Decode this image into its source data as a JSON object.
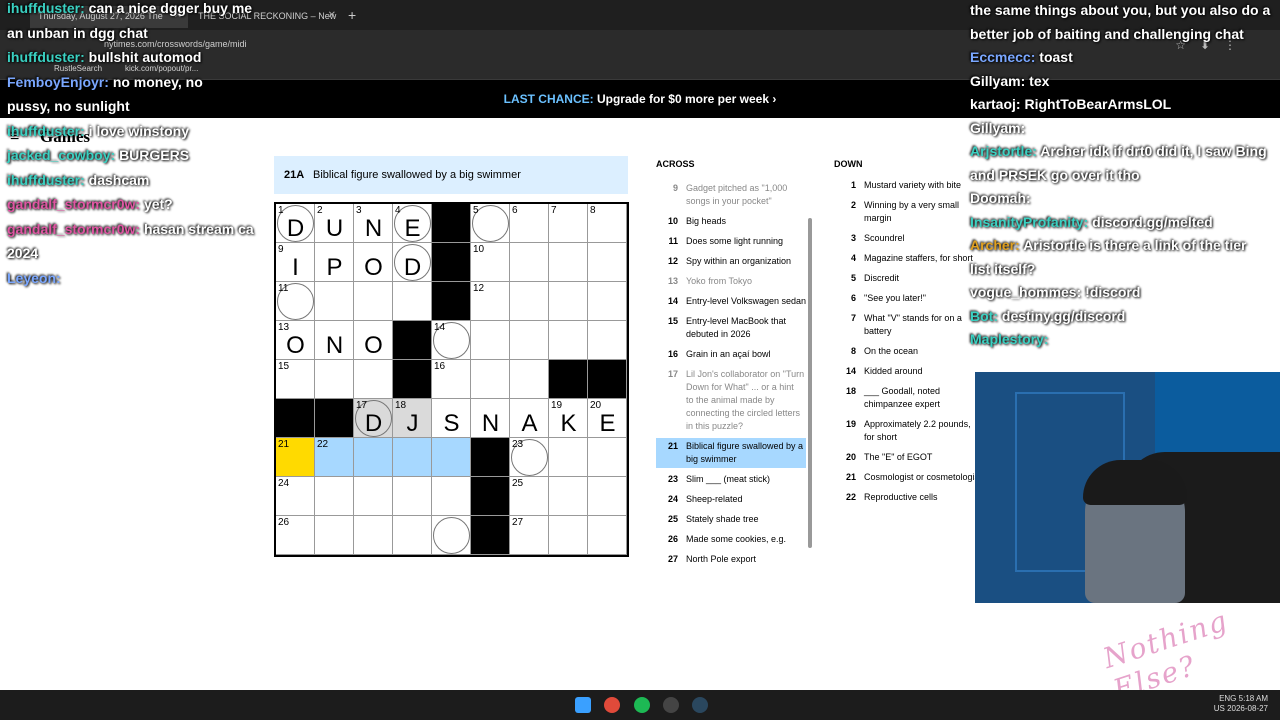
{
  "browser": {
    "tabs": [
      {
        "label": "Thursday, August 27, 2026 The"
      },
      {
        "label": "THE SOCIAL RECKONING – New"
      }
    ],
    "url": "nytimes.com/crosswords/game/midi",
    "bookmarks": [
      {
        "label": "RustleSearch"
      },
      {
        "label": "kick.com/popout/pr..."
      }
    ]
  },
  "banner": {
    "prefix": "LAST CHANCE:",
    "text": "Upgrade for $0 more per week",
    "chevron": "›"
  },
  "brand": {
    "logo": "Games"
  },
  "clue_bar": {
    "number": "21A",
    "text": "Biblical figure swallowed by a big swimmer"
  },
  "grid": {
    "size": 9,
    "cells": [
      {
        "r": 0,
        "c": 0,
        "n": "1",
        "l": "D",
        "circle": true
      },
      {
        "r": 0,
        "c": 1,
        "n": "2",
        "l": "U"
      },
      {
        "r": 0,
        "c": 2,
        "n": "3",
        "l": "N"
      },
      {
        "r": 0,
        "c": 3,
        "n": "4",
        "l": "E",
        "circle": true
      },
      {
        "r": 0,
        "c": 4,
        "black": true
      },
      {
        "r": 0,
        "c": 5,
        "n": "5",
        "circle": true
      },
      {
        "r": 0,
        "c": 6,
        "n": "6"
      },
      {
        "r": 0,
        "c": 7,
        "n": "7"
      },
      {
        "r": 0,
        "c": 8,
        "n": "8"
      },
      {
        "r": 1,
        "c": 0,
        "n": "9",
        "l": "I"
      },
      {
        "r": 1,
        "c": 1,
        "l": "P"
      },
      {
        "r": 1,
        "c": 2,
        "l": "O"
      },
      {
        "r": 1,
        "c": 3,
        "l": "D",
        "circle": true
      },
      {
        "r": 1,
        "c": 4,
        "black": true
      },
      {
        "r": 1,
        "c": 5,
        "n": "10"
      },
      {
        "r": 1,
        "c": 6
      },
      {
        "r": 1,
        "c": 7
      },
      {
        "r": 1,
        "c": 8
      },
      {
        "r": 2,
        "c": 0,
        "n": "11",
        "circle": true
      },
      {
        "r": 2,
        "c": 1
      },
      {
        "r": 2,
        "c": 2
      },
      {
        "r": 2,
        "c": 3
      },
      {
        "r": 2,
        "c": 4,
        "black": true
      },
      {
        "r": 2,
        "c": 5,
        "n": "12"
      },
      {
        "r": 2,
        "c": 6
      },
      {
        "r": 2,
        "c": 7
      },
      {
        "r": 2,
        "c": 8
      },
      {
        "r": 3,
        "c": 0,
        "n": "13",
        "l": "O"
      },
      {
        "r": 3,
        "c": 1,
        "l": "N"
      },
      {
        "r": 3,
        "c": 2,
        "l": "O"
      },
      {
        "r": 3,
        "c": 3,
        "black": true
      },
      {
        "r": 3,
        "c": 4,
        "n": "14",
        "circle": true
      },
      {
        "r": 3,
        "c": 5
      },
      {
        "r": 3,
        "c": 6
      },
      {
        "r": 3,
        "c": 7
      },
      {
        "r": 3,
        "c": 8
      },
      {
        "r": 4,
        "c": 0,
        "n": "15"
      },
      {
        "r": 4,
        "c": 1
      },
      {
        "r": 4,
        "c": 2
      },
      {
        "r": 4,
        "c": 3,
        "black": true
      },
      {
        "r": 4,
        "c": 4,
        "n": "16"
      },
      {
        "r": 4,
        "c": 5
      },
      {
        "r": 4,
        "c": 6
      },
      {
        "r": 4,
        "c": 7,
        "black": true
      },
      {
        "r": 4,
        "c": 8,
        "black": true
      },
      {
        "r": 5,
        "c": 0,
        "black": true
      },
      {
        "r": 5,
        "c": 1,
        "black": true
      },
      {
        "r": 5,
        "c": 2,
        "n": "17",
        "l": "D",
        "rel": true,
        "circle": true
      },
      {
        "r": 5,
        "c": 3,
        "n": "18",
        "l": "J",
        "rel": true
      },
      {
        "r": 5,
        "c": 4,
        "l": "S"
      },
      {
        "r": 5,
        "c": 5,
        "l": "N"
      },
      {
        "r": 5,
        "c": 6,
        "l": "A"
      },
      {
        "r": 5,
        "c": 7,
        "n": "19",
        "l": "K"
      },
      {
        "r": 5,
        "c": 8,
        "n": "20",
        "l": "E"
      },
      {
        "r": 6,
        "c": 0,
        "n": "21",
        "sel": true
      },
      {
        "r": 6,
        "c": 1,
        "n": "22",
        "hl": true
      },
      {
        "r": 6,
        "c": 2,
        "hl": true
      },
      {
        "r": 6,
        "c": 3,
        "hl": true
      },
      {
        "r": 6,
        "c": 4,
        "hl": true
      },
      {
        "r": 6,
        "c": 5,
        "black": true
      },
      {
        "r": 6,
        "c": 6,
        "n": "23",
        "circle": true
      },
      {
        "r": 6,
        "c": 7
      },
      {
        "r": 6,
        "c": 8
      },
      {
        "r": 7,
        "c": 0,
        "n": "24"
      },
      {
        "r": 7,
        "c": 1
      },
      {
        "r": 7,
        "c": 2
      },
      {
        "r": 7,
        "c": 3
      },
      {
        "r": 7,
        "c": 4
      },
      {
        "r": 7,
        "c": 5,
        "black": true
      },
      {
        "r": 7,
        "c": 6,
        "n": "25"
      },
      {
        "r": 7,
        "c": 7
      },
      {
        "r": 7,
        "c": 8
      },
      {
        "r": 8,
        "c": 0,
        "n": "26"
      },
      {
        "r": 8,
        "c": 1
      },
      {
        "r": 8,
        "c": 2
      },
      {
        "r": 8,
        "c": 3
      },
      {
        "r": 8,
        "c": 4,
        "circle": true
      },
      {
        "r": 8,
        "c": 5,
        "black": true
      },
      {
        "r": 8,
        "c": 6,
        "n": "27"
      },
      {
        "r": 8,
        "c": 7
      },
      {
        "r": 8,
        "c": 8
      }
    ]
  },
  "across": {
    "title": "ACROSS",
    "clues": [
      {
        "n": "9",
        "t": "Gadget pitched as \"1,000\nsongs in your pocket\"",
        "dim": true
      },
      {
        "n": "10",
        "t": "Big heads"
      },
      {
        "n": "11",
        "t": "Does some light running"
      },
      {
        "n": "12",
        "t": "Spy within an organization"
      },
      {
        "n": "13",
        "t": "Yoko from Tokyo",
        "dim": true
      },
      {
        "n": "14",
        "t": "Entry-level Volkswagen sedan"
      },
      {
        "n": "15",
        "t": "Entry-level MacBook that\ndebuted in 2026"
      },
      {
        "n": "16",
        "t": "Grain in an açaí bowl"
      },
      {
        "n": "17",
        "t": "Lil Jon's collaborator on \"Turn\nDown for What\" ... or a hint\nto the animal made by\nconnecting the circled letters\nin this puzzle?",
        "dim": true
      },
      {
        "n": "21",
        "t": "Biblical figure swallowed by a\nbig swimmer",
        "active": true
      },
      {
        "n": "23",
        "t": "Slim ___ (meat stick)"
      },
      {
        "n": "24",
        "t": "Sheep-related"
      },
      {
        "n": "25",
        "t": "Stately shade tree"
      },
      {
        "n": "26",
        "t": "Made some cookies, e.g."
      },
      {
        "n": "27",
        "t": "North Pole export"
      }
    ]
  },
  "down": {
    "title": "DOWN",
    "clues": [
      {
        "n": "1",
        "t": "Mustard variety with bite"
      },
      {
        "n": "2",
        "t": "Winning by a very small\nmargin"
      },
      {
        "n": "3",
        "t": "Scoundrel"
      },
      {
        "n": "4",
        "t": "Magazine staffers, for short"
      },
      {
        "n": "5",
        "t": "Discredit"
      },
      {
        "n": "6",
        "t": "\"See you later!\""
      },
      {
        "n": "7",
        "t": "What \"V\" stands for on a\nbattery"
      },
      {
        "n": "8",
        "t": "On the ocean"
      },
      {
        "n": "14",
        "t": "Kidded around"
      },
      {
        "n": "18",
        "t": "___ Goodall, noted\nchimpanzee expert"
      },
      {
        "n": "19",
        "t": "Approximately 2.2 pounds,\nfor short"
      },
      {
        "n": "20",
        "t": "The \"E\" of EGOT"
      },
      {
        "n": "21",
        "t": "Cosmologist or cosmetologis"
      },
      {
        "n": "22",
        "t": "Reproductive cells"
      }
    ]
  },
  "chat_left": [
    {
      "user": "ihuffduster",
      "msg": "can a nice dgger buy me",
      "color": "#3ad1c2"
    },
    {
      "user": "",
      "msg": "an unban in dgg chat",
      "color": "#ffffff"
    },
    {
      "user": "ihuffduster",
      "msg": "bullshit automod",
      "color": "#3ad1c2"
    },
    {
      "user": "FemboyEnjoyr",
      "msg": "no money, no",
      "color": "#7aa7ff"
    },
    {
      "user": "",
      "msg": "pussy, no sunlight",
      "color": "#ffffff"
    },
    {
      "user": "ihuffduster",
      "msg": "i love winstony",
      "color": "#3ad1c2"
    },
    {
      "user": "jacked_cowboy",
      "msg": "BURGERS",
      "color": "#3ad1c2"
    },
    {
      "user": "ihuffduster",
      "msg": "dashcam",
      "color": "#3ad1c2"
    },
    {
      "user": "gandalf_stormcr0w",
      "msg": "yet?",
      "color": "#e055a3"
    },
    {
      "user": "gandalf_stormcr0w",
      "msg": "hasan stream ca",
      "color": "#e055a3"
    },
    {
      "user": "",
      "msg": "2024",
      "color": "#ffffff"
    },
    {
      "user": "Leyeon",
      "msg": "",
      "color": "#7aa7ff"
    }
  ],
  "chat_right": [
    {
      "user": "",
      "msg": "the same things about you, but you also do a",
      "color": "#ffffff"
    },
    {
      "user": "",
      "msg": "better job of baiting and challenging chat",
      "color": "#ffffff"
    },
    {
      "user": "Eccmecc",
      "msg": "toast",
      "color": "#7aa7ff"
    },
    {
      "user": "Gillyam",
      "msg": "tex",
      "color": "#ffffff"
    },
    {
      "user": "kartaoj",
      "msg": "RightToBearArmsLOL",
      "color": "#ffffff"
    },
    {
      "user": "Gillyam",
      "msg": "",
      "color": "#ffffff"
    },
    {
      "user": "Arjstortle",
      "msg": "Archer idk if drt0 did it, I saw Bing",
      "color": "#3ad1c2"
    },
    {
      "user": "",
      "msg": "and PRSEK go over it tho",
      "color": "#ffffff"
    },
    {
      "user": "Doomah",
      "msg": "",
      "color": "#ffffff"
    },
    {
      "user": "InsanityProfanity",
      "msg": "discord.gg/melted",
      "color": "#3ad1c2"
    },
    {
      "user": "Archer",
      "msg": "Aristortle is there a link of the tier",
      "color": "#e0a020"
    },
    {
      "user": "",
      "msg": "list itself?",
      "color": "#ffffff"
    },
    {
      "user": "vogue_hommes",
      "msg": "!discord",
      "color": "#ffffff"
    },
    {
      "user": "Bot",
      "msg": "destiny.gg/discord",
      "color": "#3ad1c2"
    },
    {
      "user": "Maplestory",
      "msg": "",
      "color": "#3ad1c2"
    }
  ],
  "watermark": "Nothing Else?",
  "taskbar": {
    "lang1": "ENG",
    "lang2": "US",
    "time": "5:18 AM",
    "date": "2026-08-27"
  },
  "colors": {
    "highlight": "#a7d8ff",
    "selected": "#ffda00",
    "related": "#dadada",
    "banner_accent": "#6bc1ff"
  }
}
